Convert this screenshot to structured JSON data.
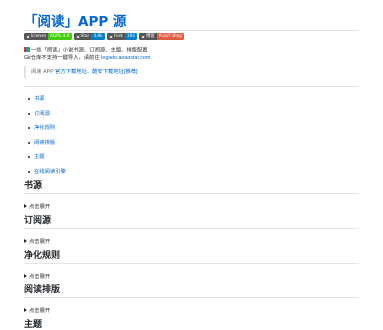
{
  "title": "「阅读」APP 源",
  "badges": [
    {
      "key": "license",
      "value": "AGPL-3.0",
      "color": "#4c1"
    },
    {
      "key": "Star",
      "value": "4.8k",
      "color": "#007ec6"
    },
    {
      "key": "Fork",
      "value": "164",
      "color": "#007ec6"
    },
    {
      "key": "博客",
      "value": "PuzzY Blog",
      "color": "#e05d44"
    }
  ],
  "intro": {
    "line1": "一些「阅读」小说书源、订阅源、主题、排版配置",
    "line2_prefix": "Git仓库不支持一键导入，请前往 ",
    "line2_link": "legado.aoaostar.com"
  },
  "quote": {
    "prefix": "阅读 APP ",
    "link1": "官方下载地址",
    "sep": "、",
    "link2": "酷安下载地址[推荐]"
  },
  "toc": [
    "书源",
    "订阅源",
    "净化规则",
    "阅读排版",
    "主题",
    "在线阅读引擎"
  ],
  "sections": [
    {
      "title": "书源",
      "details": "点击展开"
    },
    {
      "title": "订阅源",
      "details": "点击展开"
    },
    {
      "title": "净化规则",
      "details": "点击展开"
    },
    {
      "title": "阅读排版",
      "details": "点击展开"
    },
    {
      "title": "主题",
      "details": ""
    }
  ]
}
